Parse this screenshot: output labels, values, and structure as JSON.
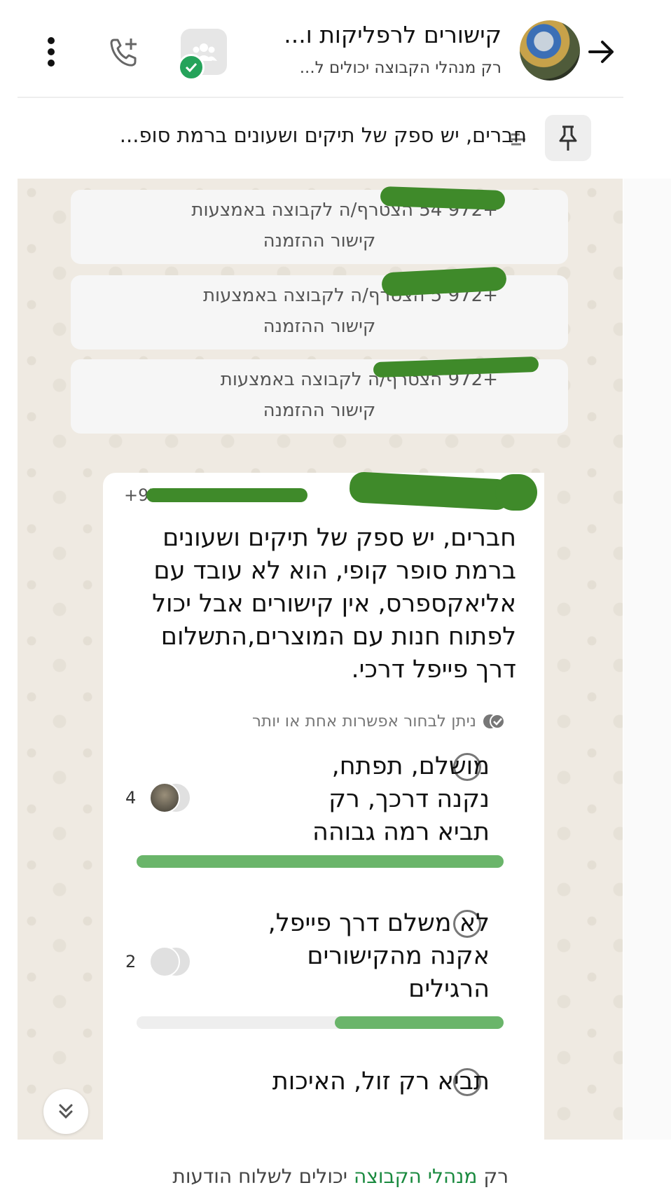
{
  "header": {
    "title": "קישורים לרפליקות ו...",
    "subtitle": "רק מנהלי הקבוצה יכולים ל..."
  },
  "pinned": {
    "text": "חברים, יש ספק של תיקים ושעונים ברמת סופ..."
  },
  "system_messages": [
    {
      "line1": "+972 54 הצטרף/ה לקבוצה באמצעות",
      "line2": "קישור ההזמנה"
    },
    {
      "line1": "+972 5 הצטרף/ה לקבוצה באמצעות",
      "line2": "קישור ההזמנה"
    },
    {
      "line1": "+972 הצטרף/ה לקבוצה באמצעות",
      "line2": "קישור ההזמנה"
    }
  ],
  "poll": {
    "sender": "+97",
    "question": "חברים, יש ספק של תיקים ושעונים ברמת סופר קופי, הוא לא עובד עם אליאקספרס, אין קישורים אבל יכול לפתוח חנות עם המוצרים,התשלום דרך פייפל דרכי.",
    "multi_hint": "ניתן לבחור אפשרות אחת או יותר",
    "options": [
      {
        "text": "מושלם, תפתח, נקנה דרכך, רק תביא רמה גבוהה",
        "count": "4",
        "fill": 1.0
      },
      {
        "text": "לא משלם דרך פייפל, אקנה מהקישורים הרגילים",
        "count": "2",
        "fill": 0.46
      },
      {
        "text": "תביא רק זול, האיכות",
        "count": "",
        "fill": 0
      }
    ]
  },
  "footer": {
    "prefix": "רק ",
    "link": "מנהלי הקבוצה",
    "suffix": " יכולים לשלוח הודעות"
  },
  "colors": {
    "accent": "#1a8a3f",
    "bar": "#6ab56a",
    "badge": "#25a35a"
  },
  "icons": [
    "back-arrow-icon",
    "group-community-icon",
    "add-call-icon",
    "more-vertical-icon",
    "pin-icon",
    "scroll-down-icon"
  ]
}
